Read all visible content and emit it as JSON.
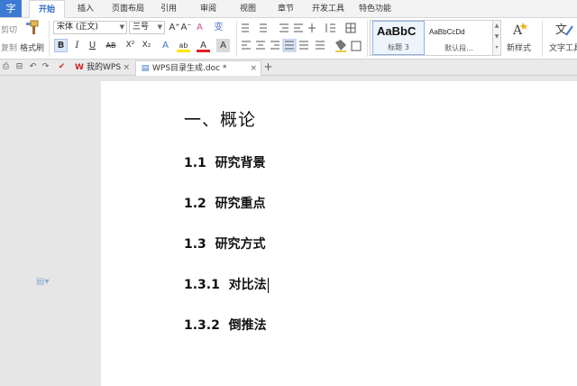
{
  "app": {
    "title_glyph": "字"
  },
  "menu_tabs": [
    {
      "label": "开始",
      "active": true
    },
    {
      "label": "插入"
    },
    {
      "label": "页面布局"
    },
    {
      "label": "引用"
    },
    {
      "label": "审阅"
    },
    {
      "label": "视图"
    },
    {
      "label": "章节"
    },
    {
      "label": "开发工具"
    },
    {
      "label": "特色功能"
    }
  ],
  "ribbon": {
    "cut_label": "剪切",
    "copy_label": "复制",
    "format_painter_label": "格式刷",
    "font_name": "宋体 (正文)",
    "font_size": "三号",
    "bold_glyph": "B",
    "italic_glyph": "I",
    "underline_glyph": "U",
    "strike_glyph": "AB",
    "superscript_glyph": "X²",
    "subscript_glyph": "X₂",
    "grow_font_glyph": "A⁺",
    "shrink_font_glyph": "A⁻",
    "clear_format_glyph": "A",
    "pinyin_glyph": "变",
    "text_effect_glyph": "A",
    "highlight_glyph": "ab",
    "font_color_glyph": "A",
    "char_shading_glyph": "A",
    "styles": [
      {
        "preview": "AaBbC",
        "name": "标题 3",
        "selected": true
      },
      {
        "preview": "AaBbCcDd",
        "name": "默认段..."
      }
    ],
    "new_style_label": "新样式",
    "text_tool_label": "文字工具",
    "accent_color": "#2f6fc7"
  },
  "doc_tabs": [
    {
      "label": "我的WPS",
      "icon": "wps-logo-icon"
    },
    {
      "label": "WPS目录生成.doc *",
      "icon": "doc-file-icon",
      "active": true
    }
  ],
  "new_tab_glyph": "+",
  "document": {
    "h1": "一、概论",
    "items": [
      {
        "num": "1.1",
        "text": "研究背景"
      },
      {
        "num": "1.2",
        "text": "研究重点"
      },
      {
        "num": "1.3",
        "text": "研究方式"
      },
      {
        "num": "1.3.1",
        "text": "对比法"
      },
      {
        "num": "1.3.2",
        "text": "倒推法"
      }
    ]
  }
}
